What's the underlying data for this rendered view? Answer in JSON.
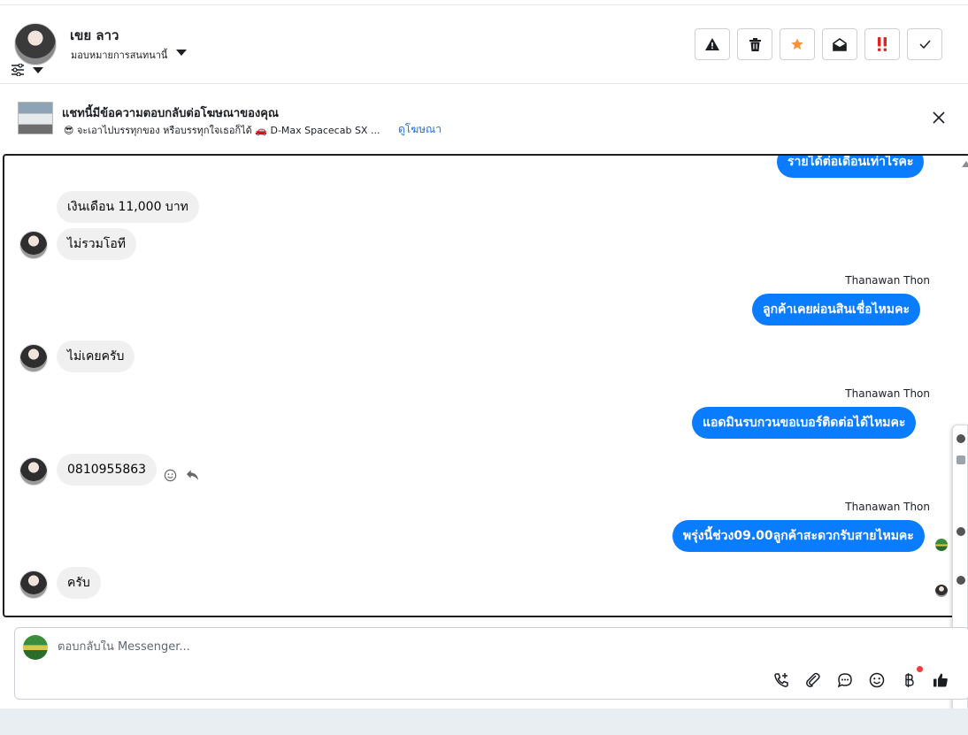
{
  "header": {
    "contact_name": "เขย ลาว",
    "assign_label": "มอบหมายการสนทนานี้",
    "actions": [
      {
        "name": "spam-button",
        "icon": "warning-icon"
      },
      {
        "name": "delete-button",
        "icon": "trash-icon"
      },
      {
        "name": "star-button",
        "icon": "star-icon"
      },
      {
        "name": "mark-unread-button",
        "icon": "envelope-open-icon"
      },
      {
        "name": "follow-up-button",
        "icon": "double-exclamation-icon"
      },
      {
        "name": "mark-done-button",
        "icon": "check-icon"
      }
    ]
  },
  "ad_banner": {
    "title": "แชทนี้มีข้อความตอบกลับต่อโฆษณาของคุณ",
    "subtitle": "😎 จะเอาไปบรรทุกของ หรือบรรทุกใจเธอก็ได้ 🚗 D-Max Spacecab SX ...",
    "link": "ดูโฆษณา"
  },
  "messages": [
    {
      "dir": "out",
      "text": "รายได้ต่อเดือนเท่าไรคะ"
    },
    {
      "dir": "in",
      "text": "เงินเดือน 11,000 บาท"
    },
    {
      "dir": "in",
      "text": "ไม่รวมโอที"
    },
    {
      "dir": "out",
      "sender": "Thanawan Thon",
      "text": "ลูกค้าเคยผ่อนสินเชื่อไหมคะ"
    },
    {
      "dir": "in",
      "text": "ไม่เคยครับ"
    },
    {
      "dir": "out",
      "sender": "Thanawan Thon",
      "text": "แอดมินรบกวนขอเบอร์ติดต่อได้ไหมคะ"
    },
    {
      "dir": "in",
      "text": "0810955863"
    },
    {
      "dir": "out",
      "sender": "Thanawan Thon",
      "text": "พรุ่งนี้ช่วง09.00ลูกค้าสะดวกรับสายไหมคะ"
    },
    {
      "dir": "in",
      "text": "ครับ"
    }
  ],
  "composer": {
    "placeholder": "ตอบกลับใน Messenger...",
    "value": "",
    "icons": [
      "call-add-icon",
      "attachment-icon",
      "saved-reply-icon",
      "emoji-icon",
      "payment-icon",
      "thumbs-up-icon"
    ]
  },
  "colors": {
    "outgoing_bubble": "#0a7cff",
    "incoming_bubble": "#f0f0f0",
    "link": "#216fdb"
  }
}
